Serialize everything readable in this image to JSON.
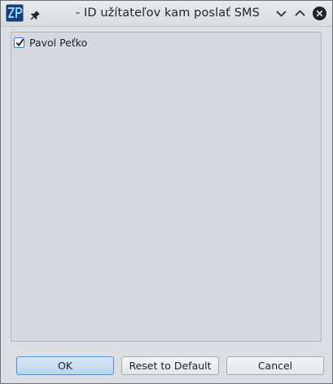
{
  "window": {
    "title": "- ID užítateľov kam poslať SMS",
    "icons": {
      "app": "zp-app-icon",
      "pin": "pin-icon",
      "minimize": "chevron-down-icon",
      "maximize": "chevron-up-icon",
      "close": "close-icon"
    }
  },
  "list": {
    "items": [
      {
        "label": "Pavol Peťko",
        "checked": true
      }
    ]
  },
  "buttons": {
    "ok": "OK",
    "reset": "Reset to Default",
    "cancel": "Cancel"
  },
  "colors": {
    "accent": "#3d6fb6",
    "background": "#dcdee3"
  }
}
